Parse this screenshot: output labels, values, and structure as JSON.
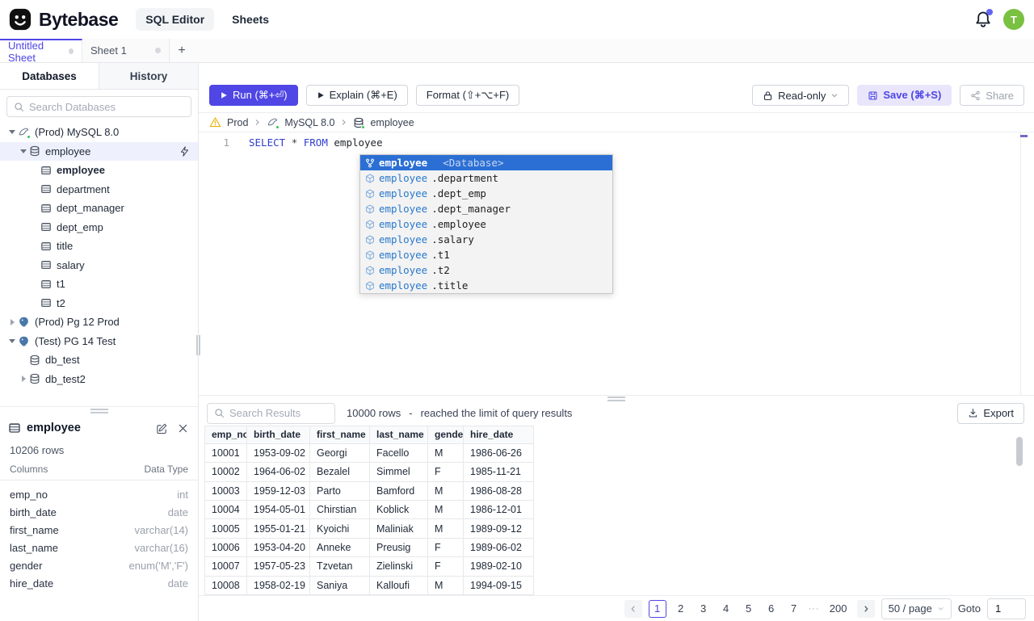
{
  "header": {
    "brand": "Bytebase",
    "nav_sql_editor": "SQL Editor",
    "nav_sheets": "Sheets",
    "avatar": "T",
    "accent_color": "#4f46e5",
    "avatar_color": "#7ac142"
  },
  "sheetbar": {
    "tab1": "Untitled Sheet",
    "tab2": "Sheet 1",
    "add": "+"
  },
  "sidebar": {
    "tab_databases": "Databases",
    "tab_history": "History",
    "search_placeholder": "Search Databases",
    "tree": [
      {
        "label": "(Prod) MySQL 8.0",
        "icon": "mysql-instance-icon",
        "caret": "down"
      },
      {
        "label": "employee",
        "icon": "database-icon",
        "caret": "down",
        "selected": true
      },
      {
        "label": "employee",
        "icon": "table-icon",
        "bold": true
      },
      {
        "label": "department",
        "icon": "table-icon"
      },
      {
        "label": "dept_manager",
        "icon": "table-icon"
      },
      {
        "label": "dept_emp",
        "icon": "table-icon"
      },
      {
        "label": "title",
        "icon": "table-icon"
      },
      {
        "label": "salary",
        "icon": "table-icon"
      },
      {
        "label": "t1",
        "icon": "table-icon"
      },
      {
        "label": "t2",
        "icon": "table-icon"
      },
      {
        "label": "(Prod) Pg 12 Prod",
        "icon": "postgres-instance-icon",
        "caret": "right"
      },
      {
        "label": "(Test) PG 14 Test",
        "icon": "postgres-instance-icon",
        "caret": "down"
      },
      {
        "label": "db_test",
        "icon": "database-icon"
      },
      {
        "label": "db_test2",
        "icon": "database-icon",
        "caret": "right"
      }
    ]
  },
  "toolbar": {
    "run": "Run (⌘+⏎)",
    "explain": "Explain (⌘+E)",
    "format": "Format (⇧+⌥+F)",
    "readonly": "Read-only",
    "save": "Save (⌘+S)",
    "share": "Share"
  },
  "breadcrumb": {
    "env": "Prod",
    "instance": "MySQL 8.0",
    "database": "employee"
  },
  "editor": {
    "line_no": "1",
    "kw_select": "SELECT",
    "star": "*",
    "kw_from": "FROM",
    "table": "employee"
  },
  "autocomplete": {
    "selected": {
      "name": "employee",
      "detail": "<Database>"
    },
    "items": [
      {
        "prefix": "employee",
        "suffix": ".department"
      },
      {
        "prefix": "employee",
        "suffix": ".dept_emp"
      },
      {
        "prefix": "employee",
        "suffix": ".dept_manager"
      },
      {
        "prefix": "employee",
        "suffix": ".employee"
      },
      {
        "prefix": "employee",
        "suffix": ".salary"
      },
      {
        "prefix": "employee",
        "suffix": ".t1"
      },
      {
        "prefix": "employee",
        "suffix": ".t2"
      },
      {
        "prefix": "employee",
        "suffix": ".title"
      }
    ]
  },
  "detail_panel": {
    "title": "employee",
    "row_count": "10206 rows",
    "columns_header": "Columns",
    "type_header": "Data Type",
    "columns": [
      {
        "name": "emp_no",
        "type": "int"
      },
      {
        "name": "birth_date",
        "type": "date"
      },
      {
        "name": "first_name",
        "type": "varchar(14)"
      },
      {
        "name": "last_name",
        "type": "varchar(16)"
      },
      {
        "name": "gender",
        "type": "enum('M','F')"
      },
      {
        "name": "hire_date",
        "type": "date"
      }
    ]
  },
  "results": {
    "search_placeholder": "Search Results",
    "row_count": "10000 rows",
    "separator": "-",
    "limit_note": "reached the limit of query results",
    "export": "Export",
    "columns": [
      "emp_no",
      "birth_date",
      "first_name",
      "last_name",
      "gender",
      "hire_date"
    ],
    "rows": [
      [
        "10001",
        "1953-09-02",
        "Georgi",
        "Facello",
        "M",
        "1986-06-26"
      ],
      [
        "10002",
        "1964-06-02",
        "Bezalel",
        "Simmel",
        "F",
        "1985-11-21"
      ],
      [
        "10003",
        "1959-12-03",
        "Parto",
        "Bamford",
        "M",
        "1986-08-28"
      ],
      [
        "10004",
        "1954-05-01",
        "Chirstian",
        "Koblick",
        "M",
        "1986-12-01"
      ],
      [
        "10005",
        "1955-01-21",
        "Kyoichi",
        "Maliniak",
        "M",
        "1989-09-12"
      ],
      [
        "10006",
        "1953-04-20",
        "Anneke",
        "Preusig",
        "F",
        "1989-06-02"
      ],
      [
        "10007",
        "1957-05-23",
        "Tzvetan",
        "Zielinski",
        "F",
        "1989-02-10"
      ],
      [
        "10008",
        "1958-02-19",
        "Saniya",
        "Kalloufi",
        "M",
        "1994-09-15"
      ]
    ]
  },
  "pagination": {
    "pages": [
      "1",
      "2",
      "3",
      "4",
      "5",
      "6",
      "7"
    ],
    "ellipsis": "···",
    "last_page": "200",
    "page_size": "50 / page",
    "goto_label": "Goto",
    "goto_value": "1"
  }
}
